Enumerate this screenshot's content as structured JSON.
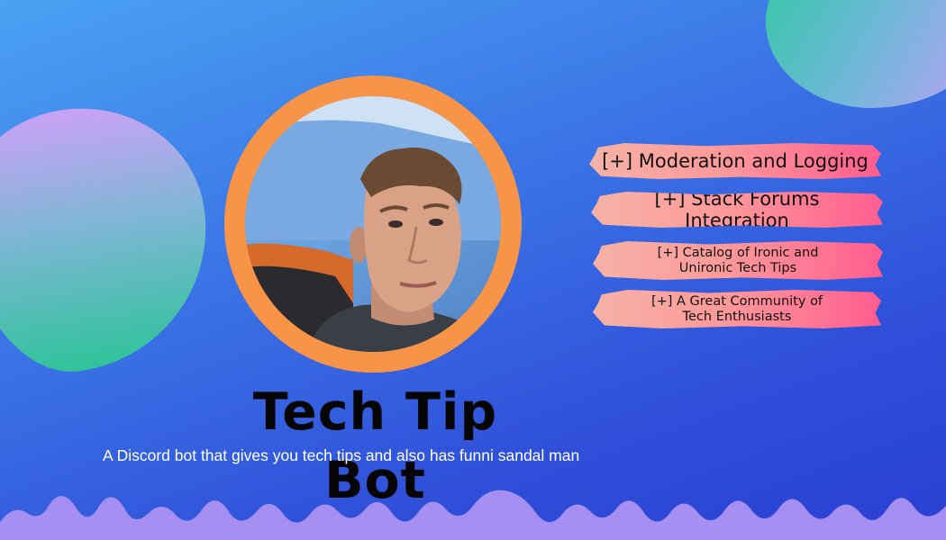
{
  "banner": {
    "title": "Tech Tip Bot",
    "description": "A Discord bot that gives you tech tips and also has funni sandal man",
    "avatar": "portrait-photo",
    "colors": {
      "background_start": "#4aa2f3",
      "background_end": "#2a3fd3",
      "avatar_ring": "#f79447",
      "wave": "#a58ff2",
      "tag_start": "#ffb6a3",
      "tag_end": "#ff5d8f"
    }
  },
  "features": [
    {
      "label": "[+] Moderation and Logging"
    },
    {
      "label": "[+] Stack Forums Integration"
    },
    {
      "label": "[+] Catalog of Ironic and\nUnironic Tech Tips"
    },
    {
      "label": "[+] A Great Community of\nTech Enthusiasts"
    }
  ]
}
